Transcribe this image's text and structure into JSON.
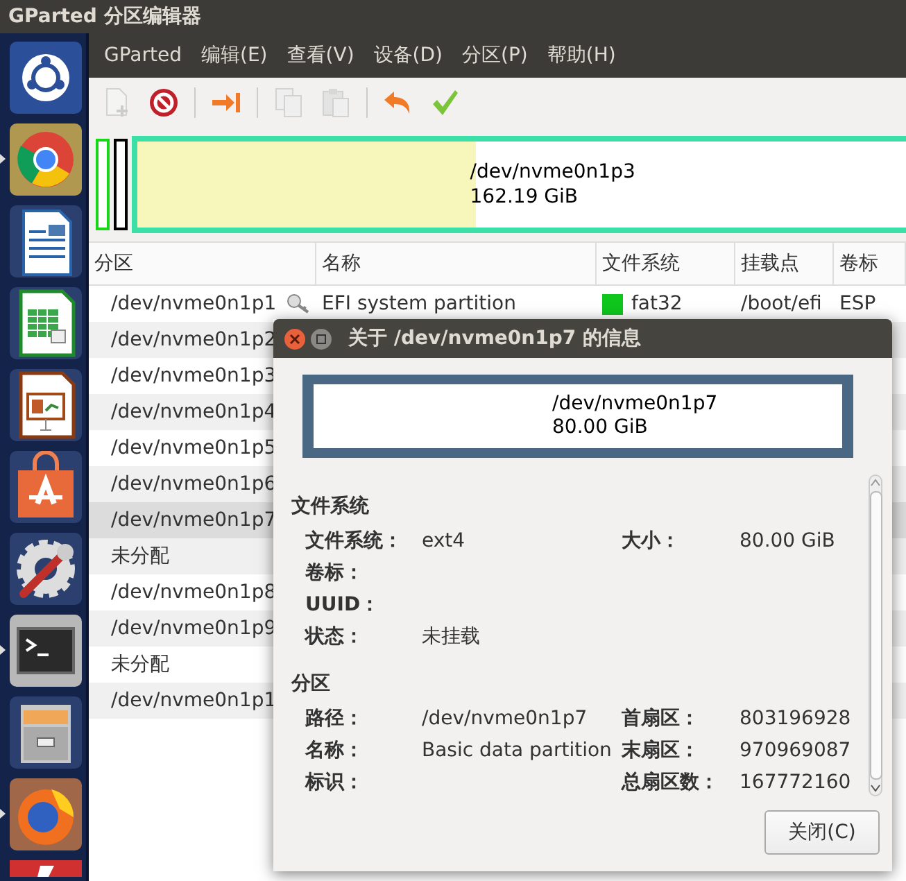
{
  "window": {
    "title": "GParted 分区编辑器"
  },
  "launcher": [
    {
      "kind": "ubuntu",
      "running": false
    },
    {
      "kind": "browser",
      "running": true
    },
    {
      "kind": "writer",
      "running": false
    },
    {
      "kind": "calc",
      "running": false
    },
    {
      "kind": "impress",
      "running": false
    },
    {
      "kind": "store",
      "running": false
    },
    {
      "kind": "settings",
      "running": false
    },
    {
      "kind": "terminal",
      "running": true
    },
    {
      "kind": "files",
      "running": false
    },
    {
      "kind": "firefox",
      "running": true
    },
    {
      "kind": "partial"
    }
  ],
  "menu": [
    "GParted",
    "编辑(E)",
    "查看(V)",
    "设备(D)",
    "分区(P)",
    "帮助(H)"
  ],
  "toolbar": [
    {
      "kind": "new",
      "disabled": true
    },
    {
      "kind": "delete",
      "disabled": false
    },
    {
      "kind": "sep"
    },
    {
      "kind": "resize",
      "disabled": false
    },
    {
      "kind": "sep"
    },
    {
      "kind": "copy",
      "disabled": true
    },
    {
      "kind": "paste",
      "disabled": true
    },
    {
      "kind": "sep"
    },
    {
      "kind": "undo",
      "disabled": false
    },
    {
      "kind": "apply",
      "disabled": false
    }
  ],
  "disk_map": {
    "path": "/dev/nvme0n1p3",
    "size": "162.19 GiB",
    "level": 0.44
  },
  "table": {
    "columns": [
      "分区",
      "名称",
      "文件系统",
      "挂载点",
      "卷标"
    ],
    "rows": [
      {
        "partition": "/dev/nvme0n1p1",
        "key": true,
        "name": "EFI system partition",
        "color": "#0fc61d",
        "filesystem": "fat32",
        "mount": "/boot/efi",
        "label": "ESP",
        "selected": false
      },
      {
        "partition": "/dev/nvme0n1p2",
        "selected": false
      },
      {
        "partition": "/dev/nvme0n1p3",
        "selected": false
      },
      {
        "partition": "/dev/nvme0n1p4",
        "selected": false
      },
      {
        "partition": "/dev/nvme0n1p5",
        "selected": false
      },
      {
        "partition": "/dev/nvme0n1p6",
        "selected": false
      },
      {
        "partition": "/dev/nvme0n1p7",
        "selected": true
      },
      {
        "partition": "未分配",
        "selected": false
      },
      {
        "partition": "/dev/nvme0n1p8",
        "selected": false
      },
      {
        "partition": "/dev/nvme0n1p9",
        "selected": false
      },
      {
        "partition": "未分配",
        "selected": false
      },
      {
        "partition": "/dev/nvme0n1p1",
        "selected": false
      }
    ]
  },
  "dialog": {
    "title": "关于 /dev/nvme0n1p7 的信息",
    "path": "/dev/nvme0n1p7",
    "size": "80.00 GiB",
    "sections": [
      {
        "title": "文件系统",
        "rows": [
          {
            "label": "文件系统：",
            "value": "ext4",
            "label2": "大小：",
            "value2": "80.00 GiB"
          },
          {
            "label": "卷标："
          },
          {
            "label": "UUID："
          },
          {
            "label": "状态：",
            "value": "未挂载"
          }
        ]
      },
      {
        "title": "分区",
        "rows": [
          {
            "label": "路径：",
            "value": "/dev/nvme0n1p7",
            "label2": "首扇区：",
            "value2": "803196928"
          },
          {
            "label": "名称：",
            "value": "Basic data partition",
            "label2": "末扇区：",
            "value2": "970969087"
          },
          {
            "label": "标识：",
            "label2": "总扇区数：",
            "value2": "167772160"
          }
        ]
      }
    ],
    "close_button": "关闭(C)"
  }
}
